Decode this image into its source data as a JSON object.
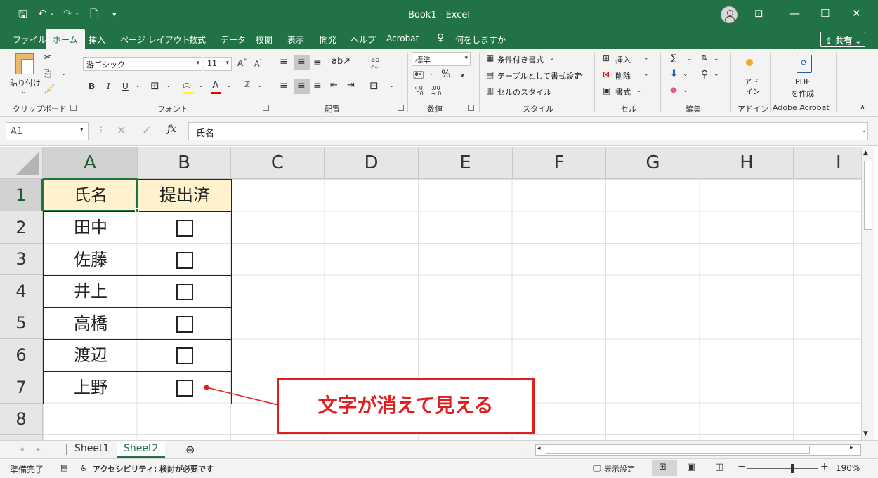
{
  "window": {
    "title": "Book1  -  Excel",
    "minimize_icon": "minimize-icon",
    "maximize_icon": "maximize-icon",
    "close_icon": "close-icon"
  },
  "menu": {
    "tabs": [
      "ファイル",
      "ホーム",
      "挿入",
      "ページ レイアウト",
      "数式",
      "データ",
      "校閲",
      "表示",
      "開発",
      "ヘルプ",
      "Acrobat"
    ],
    "active_tab": "ホーム",
    "tell_me": "何をしますか",
    "share": "共有"
  },
  "ribbon": {
    "clipboard": {
      "label": "クリップボード",
      "paste": "貼り付け"
    },
    "font": {
      "label": "フォント",
      "name": "游ゴシック",
      "size": "11"
    },
    "alignment": {
      "label": "配置"
    },
    "number": {
      "label": "数値",
      "format": "標準"
    },
    "styles": {
      "label": "スタイル",
      "conditional": "条件付き書式",
      "as_table": "テーブルとして書式設定",
      "cell_styles": "セルのスタイル"
    },
    "cells": {
      "label": "セル",
      "insert": "挿入",
      "delete": "削除",
      "format": "書式"
    },
    "editing": {
      "label": "編集"
    },
    "addins": {
      "label": "アドイン",
      "button_1": "アド",
      "button_2": "イン"
    },
    "acrobat": {
      "label": "Adobe Acrobat",
      "pdf_1": "PDF",
      "pdf_2": "を作成"
    }
  },
  "formula_bar": {
    "name_box": "A1",
    "content": "氏名"
  },
  "grid": {
    "columns": [
      "A",
      "B",
      "C",
      "D",
      "E",
      "F",
      "G",
      "H",
      "I"
    ],
    "rows": [
      "1",
      "2",
      "3",
      "4",
      "5",
      "6",
      "7",
      "8"
    ],
    "header": {
      "name": "氏名",
      "submitted": "提出済"
    },
    "names": [
      "田中",
      "佐藤",
      "井上",
      "高橋",
      "渡辺",
      "上野"
    ]
  },
  "callout": {
    "text": "文字が消えて見える"
  },
  "sheets": {
    "tabs": [
      "Sheet1",
      "Sheet2"
    ],
    "active": "Sheet2"
  },
  "status": {
    "ready": "準備完了",
    "accessibility": "アクセシビリティ: 検討が必要です",
    "display_settings": "表示設定",
    "zoom": "190%"
  }
}
